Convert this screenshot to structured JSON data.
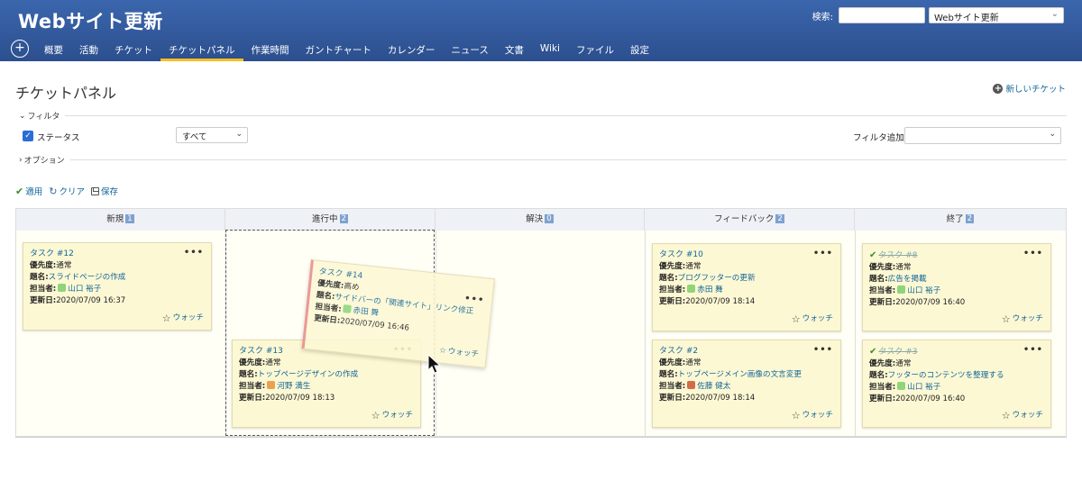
{
  "header": {
    "site_title": "Webサイト更新",
    "search_label": "検索:",
    "search_value": "",
    "project_jump": "Webサイト更新",
    "plus_label": "+",
    "menu": [
      "概要",
      "活動",
      "チケット",
      "チケットパネル",
      "作業時間",
      "ガントチャート",
      "カレンダー",
      "ニュース",
      "文書",
      "Wiki",
      "ファイル",
      "設定"
    ],
    "selected_menu": "チケットパネル"
  },
  "page": {
    "title": "チケットパネル",
    "new_issue": "新しいチケット",
    "filter_legend": "フィルタ",
    "status_label": "ステータス",
    "status_value": "すべて",
    "add_filter_label": "フィルタ追加",
    "add_filter_value": "",
    "options_legend": "オプション",
    "apply": "適用",
    "clear": "クリア",
    "save": "保存"
  },
  "columns": [
    {
      "name": "新規",
      "count": "1"
    },
    {
      "name": "進行中",
      "count": "2"
    },
    {
      "name": "解決",
      "count": "0"
    },
    {
      "name": "フィードバック",
      "count": "2"
    },
    {
      "name": "終了",
      "count": "2"
    }
  ],
  "field_labels": {
    "priority": "優先度:",
    "subject": "題名:",
    "assignee": "担当者:",
    "updated": "更新日:",
    "watch": "ウォッチ",
    "menu_dots": "•••"
  },
  "cards": [
    {
      "id": "タスク #12",
      "priority": "通常",
      "subject": "スライドページの作成",
      "assignee": "山口 裕子",
      "updated": "2020/07/09 16:37"
    },
    {
      "id": "タスク #13",
      "priority": "通常",
      "subject": "トップページデザインの作成",
      "assignee": "河野 満生",
      "updated": "2020/07/09 18:13"
    },
    {
      "id": "タスク #10",
      "priority": "通常",
      "subject": "ブログフッターの更新",
      "assignee": "赤田 舞",
      "updated": "2020/07/09 18:14"
    },
    {
      "id": "タスク #2",
      "priority": "通常",
      "subject": "トップページメイン画像の文言変更",
      "assignee": "佐藤 健太",
      "updated": "2020/07/09 18:14"
    },
    {
      "id": "タスク #8",
      "priority": "通常",
      "subject": "広告を掲載",
      "assignee": "山口 裕子",
      "updated": "2020/07/09 16:40"
    },
    {
      "id": "タスク #3",
      "priority": "通常",
      "subject": "フッターのコンテンツを整理する",
      "assignee": "山口 裕子",
      "updated": "2020/07/09 16:40"
    }
  ],
  "dragging_card": {
    "id": "タスク #14",
    "priority": "高め",
    "subject": "サイドバーの「関連サイト」リンク修正",
    "assignee": "赤田 舞",
    "updated": "2020/07/09 16:46"
  }
}
